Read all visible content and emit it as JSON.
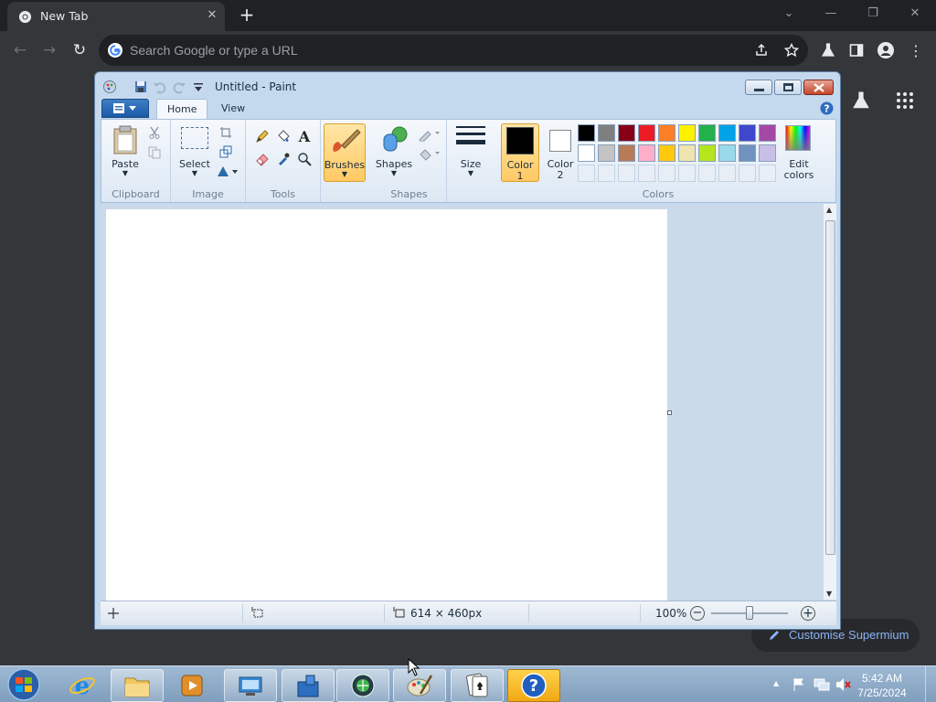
{
  "browser": {
    "tab_title": "New Tab",
    "tab_close": "✕",
    "new_tab": "+",
    "search_placeholder": "Search Google or type a URL",
    "customise_label": "Customise Supermium"
  },
  "paint": {
    "title": "Untitled - Paint",
    "tabs": [
      {
        "label": "Home",
        "active": true
      },
      {
        "label": "View",
        "active": false
      }
    ],
    "groups": {
      "clipboard": {
        "label": "Clipboard",
        "paste": "Paste"
      },
      "image": {
        "label": "Image",
        "select": "Select"
      },
      "tools": {
        "label": "Tools"
      },
      "brushes": {
        "label": "Brushes"
      },
      "shapes": {
        "label": "Shapes",
        "shapes_btn": "Shapes"
      },
      "size": {
        "label": "Size"
      },
      "colors": {
        "label": "Colors",
        "color1_line1": "Color",
        "color1_line2": "1",
        "color2_line1": "Color",
        "color2_line2": "2",
        "edit_line1": "Edit",
        "edit_line2": "colors",
        "color1_value": "#000000",
        "color2_value": "#ffffff",
        "palette_row1": [
          "#000000",
          "#7f7f7f",
          "#880015",
          "#ed1c24",
          "#ff7f27",
          "#fff200",
          "#22b14c",
          "#00a2e8",
          "#3f48cc",
          "#a349a4"
        ],
        "palette_row2": [
          "#ffffff",
          "#c3c3c3",
          "#b97a57",
          "#ffaec9",
          "#ffc90e",
          "#efe4b0",
          "#b5e61d",
          "#99d9ea",
          "#7092be",
          "#c8bfe7"
        ]
      }
    },
    "status": {
      "dimensions": "614 × 460px",
      "zoom": "100%"
    }
  },
  "taskbar": {
    "time": "5:42 AM",
    "date": "7/25/2024"
  },
  "colors": {
    "chrome_bg": "#202124",
    "paint_frame": "#c4d9ee",
    "taskbar": "#8eabc8"
  }
}
